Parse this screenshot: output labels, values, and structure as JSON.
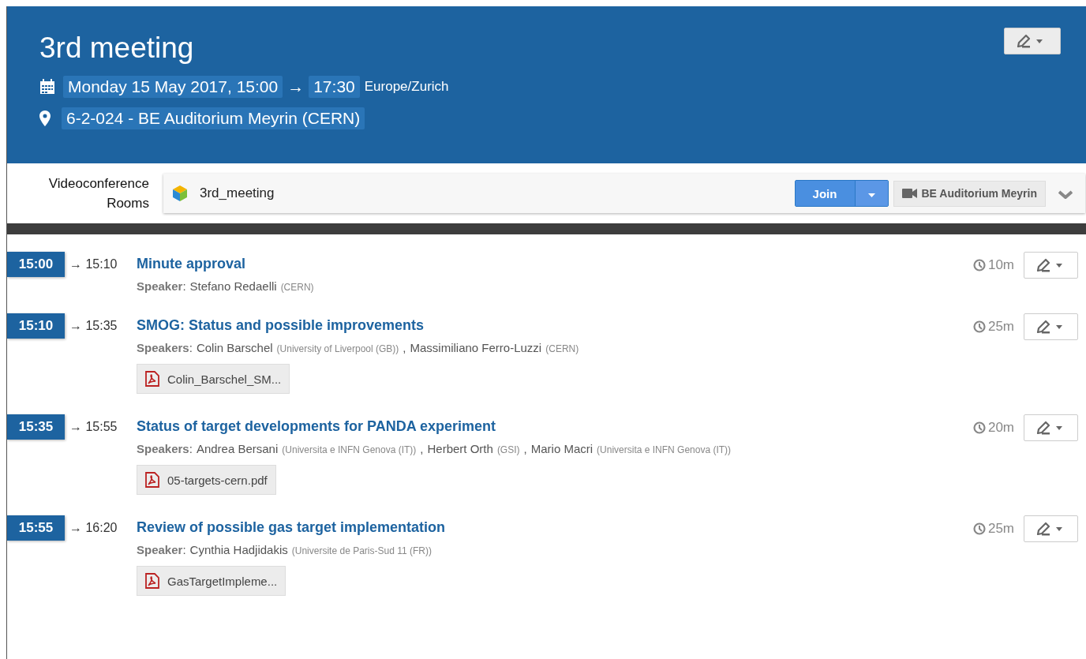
{
  "event": {
    "title": "3rd meeting",
    "start": "Monday 15 May 2017, 15:00",
    "arrow": "→",
    "end": "17:30",
    "timezone": "Europe/Zurich",
    "location": "6-2-024 - BE Auditorium Meyrin (CERN)"
  },
  "videoconference": {
    "label": "Videoconference Rooms",
    "room": "3rd_meeting",
    "join_label": "Join",
    "room_button": "BE Auditorium Meyrin"
  },
  "contributions": [
    {
      "start": "15:00",
      "end": "→ 15:10",
      "title": "Minute approval",
      "speaker_label": "**Speaker**:",
      "speakers": [
        {
          "name": "Stefano Redaelli",
          "affiliation": "(CERN)"
        }
      ],
      "duration": "10m"
    },
    {
      "start": "15:10",
      "end": "→ 15:35",
      "title": "SMOG: Status and possible improvements",
      "speaker_label": "**Speakers**:",
      "speakers": [
        {
          "name": "Colin Barschel",
          "affiliation": "(University of Liverpool (GB))"
        },
        {
          "name": "Massimiliano Ferro-Luzzi",
          "affiliation": "(CERN)"
        }
      ],
      "separator": ",",
      "duration": "25m",
      "attachments": [
        "Colin_Barschel_SM..."
      ]
    },
    {
      "start": "15:35",
      "end": "→ 15:55",
      "title": "Status of target developments for PANDA experiment",
      "speaker_label": "**Speakers**:",
      "speakers": [
        {
          "name": "Andrea Bersani",
          "affiliation": "(Universita e INFN Genova (IT))"
        },
        {
          "name": "Herbert Orth",
          "affiliation": "(GSI)"
        },
        {
          "name": "Mario Macri",
          "affiliation": "(Universita e INFN Genova (IT))"
        }
      ],
      "separator": ",",
      "duration": "20m",
      "attachments": [
        "05-targets-cern.pdf"
      ]
    },
    {
      "start": "15:55",
      "end": "→ 16:20",
      "title": "Review of possible gas target implementation",
      "speaker_label": "**Speaker**:",
      "speakers": [
        {
          "name": "Cynthia Hadjidakis",
          "affiliation": "(Universite de Paris-Sud 11 (FR))"
        }
      ],
      "duration": "25m",
      "attachments": [
        "GasTargetImpleme..."
      ]
    }
  ]
}
